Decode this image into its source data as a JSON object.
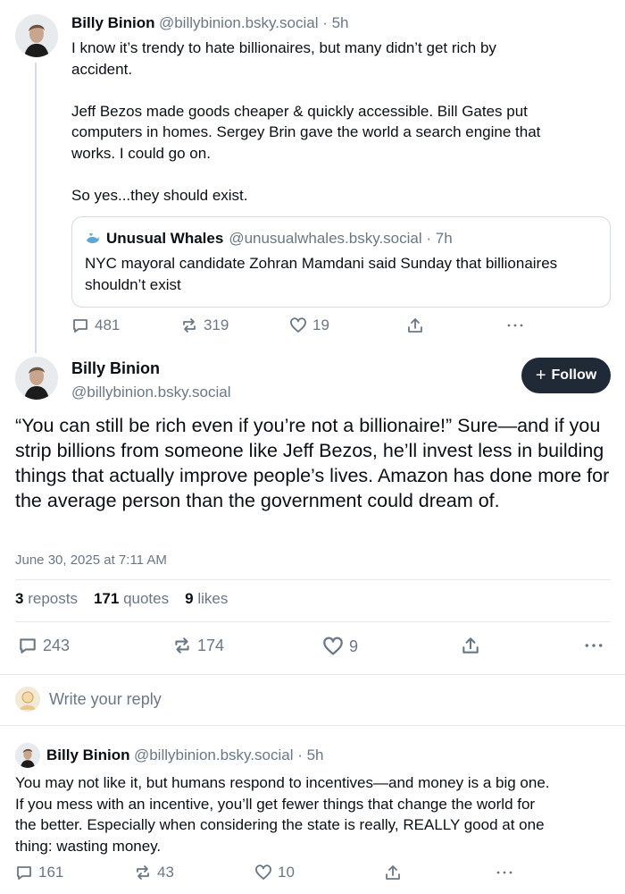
{
  "parent_post": {
    "author_name": "Billy Binion",
    "handle_time": "@billybinion.bsky.social · 5h",
    "text": "I know it’s trendy to hate billionaires, but many didn’t get rich by\naccident.\n\nJeff Bezos made goods cheaper & quickly accessible. Bill Gates put\ncomputers in homes. Sergey Brin gave the world a search engine that\nworks. I could go on.\n\nSo yes...they should exist.",
    "quote": {
      "author_name": "Unusual Whales",
      "handle_time": "@unusualwhales.bsky.social · 7h",
      "text": "NYC mayoral candidate Zohran Mamdani said Sunday that billionaires shouldn’t exist"
    },
    "actions": {
      "replies": "481",
      "reposts": "319",
      "likes": "19"
    }
  },
  "main_post": {
    "author_name": "Billy Binion",
    "handle": "@billybinion.bsky.social",
    "follow_label": "Follow",
    "text": "“You can still be rich even if you’re not a billionaire!” Sure—and if you strip billions from someone like Jeff Bezos, he’ll invest less in building things that actually improve people’s lives. Amazon has done more for the average person than the government could dream of.",
    "date": "June 30, 2025 at 7:11 AM",
    "stats": {
      "reposts_count": "3",
      "reposts_label": "reposts",
      "quotes_count": "171",
      "quotes_label": "quotes",
      "likes_count": "9",
      "likes_label": "likes"
    },
    "actions": {
      "replies": "243",
      "reposts": "174",
      "likes": "9"
    }
  },
  "reply_box": {
    "placeholder": "Write your reply"
  },
  "reply_post": {
    "author_name": "Billy Binion",
    "handle_time": "@billybinion.bsky.social · 5h",
    "text": "You may not like it, but humans respond to incentives—and money is a big one.\nIf you mess with an incentive, you’ll get fewer things that change the world for\nthe better. Especially when considering the state is really, REALLY good at one\nthing: wasting money.",
    "actions": {
      "replies": "161",
      "reposts": "43",
      "likes": "10"
    }
  },
  "icons": {
    "reply": "speech-bubble-icon",
    "repost": "repost-arrows-icon",
    "like": "heart-icon",
    "share": "share-upload-icon",
    "more": "ellipsis-icon",
    "quote_avatar": "whale-icon"
  },
  "colors": {
    "follow_bg": "#1f2a36",
    "muted": "#6b7784",
    "border": "#d4dbe2"
  }
}
